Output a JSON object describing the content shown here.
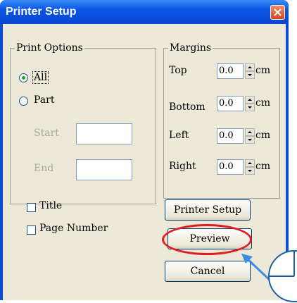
{
  "window": {
    "title": "Printer Setup"
  },
  "print_options": {
    "legend": "Print Options",
    "all_label": "All",
    "part_label": "Part",
    "selected": "All",
    "start_label": "Start",
    "end_label": "End",
    "start_value": "",
    "end_value": ""
  },
  "margins": {
    "legend": "Margins",
    "unit": "cm",
    "rows": [
      {
        "label": "Top",
        "value": "0.0"
      },
      {
        "label": "Bottom",
        "value": "0.0"
      },
      {
        "label": "Left",
        "value": "0.0"
      },
      {
        "label": "Right",
        "value": "0.0"
      }
    ]
  },
  "options": {
    "title_label": "Title",
    "page_number_label": "Page Number"
  },
  "buttons": {
    "printer_setup": "Printer Setup",
    "preview": "Preview",
    "cancel": "Cancel"
  },
  "colors": {
    "titlebar": "#0a55e6",
    "highlight_ring": "#e11d26",
    "arrow": "#3b8de0"
  }
}
